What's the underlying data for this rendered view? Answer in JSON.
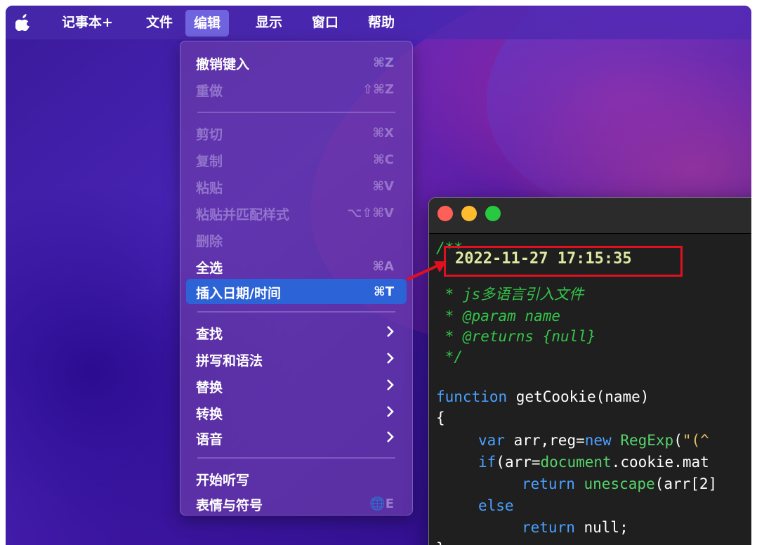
{
  "menubar": {
    "app_name": "记事本+",
    "items": [
      "文件",
      "编辑",
      "显示",
      "窗口",
      "帮助"
    ]
  },
  "edit_menu": {
    "items": [
      {
        "label": "撤销键入",
        "shortcut": "⌘Z",
        "state": "enabled"
      },
      {
        "label": "重做",
        "shortcut": "⇧⌘Z",
        "state": "disabled"
      },
      {
        "label": "剪切",
        "shortcut": "⌘X",
        "state": "disabled"
      },
      {
        "label": "复制",
        "shortcut": "⌘C",
        "state": "disabled"
      },
      {
        "label": "粘贴",
        "shortcut": "⌘V",
        "state": "disabled"
      },
      {
        "label": "粘贴并匹配样式",
        "shortcut": "⌥⇧⌘V",
        "state": "disabled"
      },
      {
        "label": "删除",
        "shortcut": "",
        "state": "disabled"
      },
      {
        "label": "全选",
        "shortcut": "⌘A",
        "state": "enabled"
      },
      {
        "label": "插入日期/时间",
        "shortcut": "⌘T",
        "state": "highlighted"
      },
      {
        "label": "查找",
        "submenu": true
      },
      {
        "label": "拼写和语法",
        "submenu": true
      },
      {
        "label": "替换",
        "submenu": true
      },
      {
        "label": "转换",
        "submenu": true
      },
      {
        "label": "语音",
        "submenu": true
      },
      {
        "label": "开始听写",
        "shortcut": "",
        "state": "enabled"
      },
      {
        "label": "表情与符号",
        "shortcut": "🌐E",
        "state": "enabled"
      }
    ]
  },
  "editor": {
    "lines": {
      "l1": "/**",
      "date": "2022-11-27 17:15:35",
      "l3": " * js多语言引入文件",
      "l4": " * @param name",
      "l5": " * @returns {null}",
      "l6": " */",
      "l8_kw": "function",
      "l8_rest": " getCookie(name)",
      "l9": "{",
      "l10_kw": "var",
      "l10_a": " arr,reg=",
      "l10_kw2": "new",
      "l10_b": " RegExp",
      "l10_c": "(",
      "l10_str": "\"(^",
      "l11_kw": "if",
      "l11_a": "(arr=",
      "l11_b": "document",
      "l11_c": ".cookie.mat",
      "l12_kw": "return",
      "l12_a": " ",
      "l12_b": "unescape",
      "l12_c": "(arr[2]",
      "l13_kw": "else",
      "l14_kw": "return",
      "l14_a": " null;",
      "l15": "}"
    }
  },
  "colors": {
    "highlight": "#2c63d6",
    "annotation_red": "#e01020",
    "comment_green": "#34c44a",
    "keyword_blue": "#4aa0ff"
  }
}
